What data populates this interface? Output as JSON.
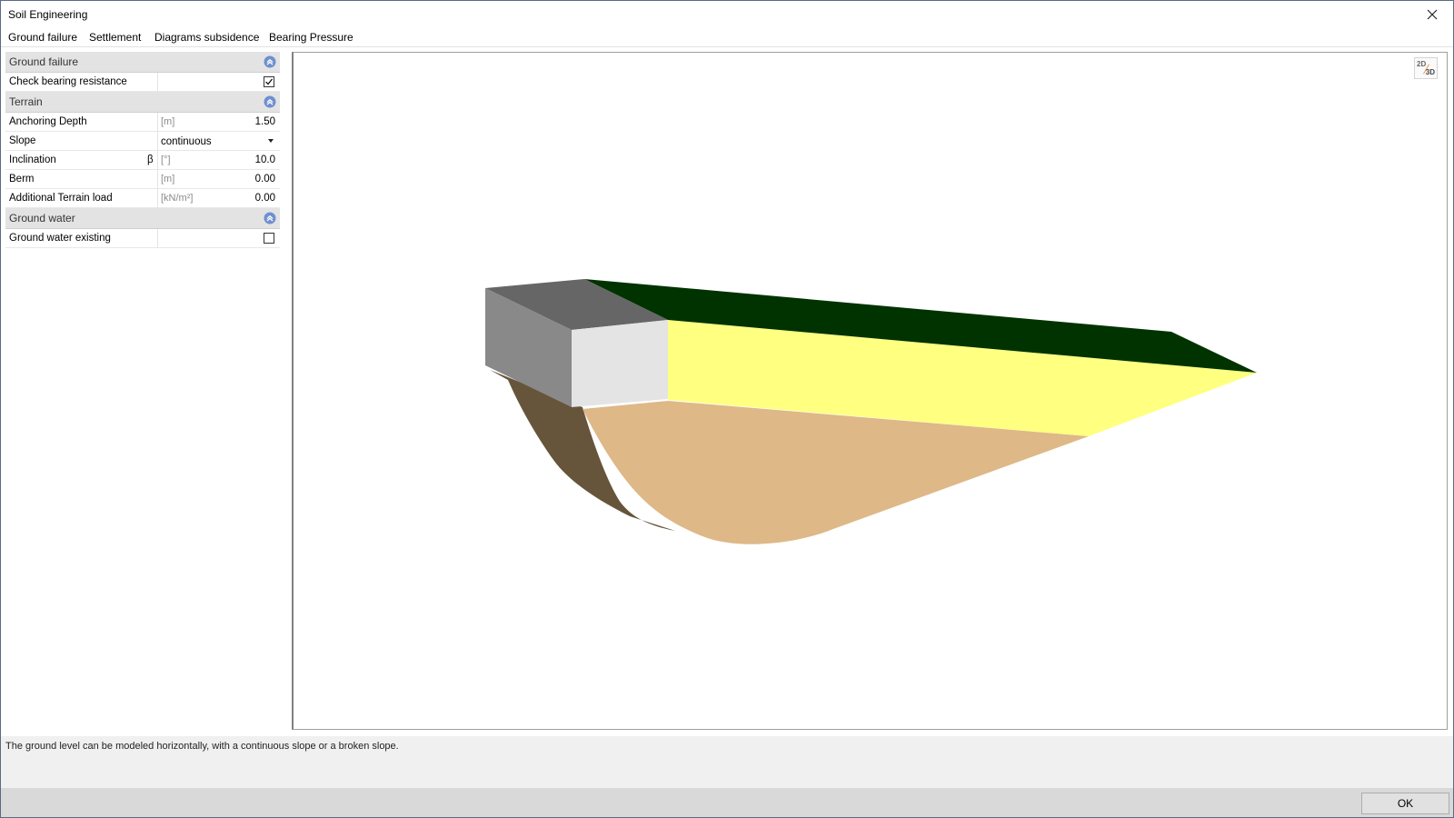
{
  "window": {
    "title": "Soil Engineering"
  },
  "menu": {
    "items": [
      {
        "label": "Ground failure"
      },
      {
        "label": "Settlement"
      },
      {
        "label": "Diagrams subsidence"
      },
      {
        "label": "Bearing Pressure"
      }
    ]
  },
  "properties": {
    "ground_failure": {
      "header": "Ground failure",
      "check_bearing": {
        "label": "Check bearing resistance",
        "checked": true
      }
    },
    "terrain": {
      "header": "Terrain",
      "anchoring_depth": {
        "label": "Anchoring Depth",
        "unit": "[m]",
        "value": "1.50"
      },
      "slope": {
        "label": "Slope",
        "value": "continuous"
      },
      "inclination": {
        "label": "Inclination",
        "symbol": "β",
        "unit": "[°]",
        "value": "10.0"
      },
      "berm": {
        "label": "Berm",
        "unit": "[m]",
        "value": "0.00"
      },
      "additional_load": {
        "label": "Additional Terrain load",
        "unit": "[kN/m²]",
        "value": "0.00"
      }
    },
    "ground_water": {
      "header": "Ground water",
      "existing": {
        "label": "Ground water existing",
        "checked": false
      }
    }
  },
  "viewport": {
    "toggle": {
      "label_2d": "2D",
      "label_3d": "3D"
    },
    "colors": {
      "terrain_top": "#003300",
      "slope_face": "#ffff80",
      "failure_body": "#deb887",
      "failure_side": "#66553b",
      "foundation_top": "#666666",
      "foundation_side": "#898989",
      "foundation_front": "#e4e4e4"
    }
  },
  "status": {
    "hint": "The ground level can be modeled horizontally, with a continuous slope or a broken slope."
  },
  "footer": {
    "ok_label": "OK"
  }
}
